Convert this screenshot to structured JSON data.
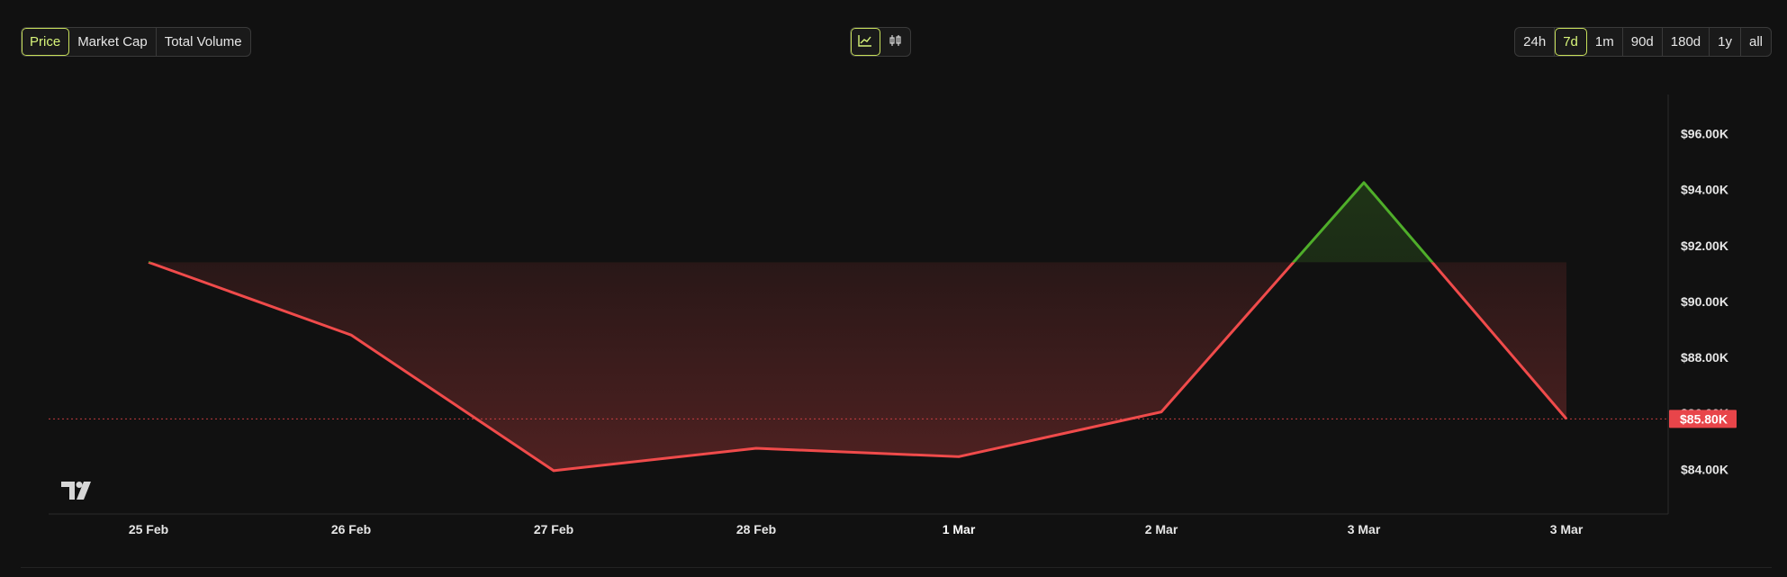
{
  "toolbar": {
    "metrics": [
      {
        "label": "Price",
        "active": true
      },
      {
        "label": "Market Cap",
        "active": false
      },
      {
        "label": "Total Volume",
        "active": false
      }
    ],
    "views": [
      {
        "icon": "line-chart-icon",
        "active": true
      },
      {
        "icon": "candlestick-icon",
        "active": false
      }
    ],
    "ranges": [
      {
        "label": "24h",
        "active": false
      },
      {
        "label": "7d",
        "active": true
      },
      {
        "label": "1m",
        "active": false
      },
      {
        "label": "90d",
        "active": false
      },
      {
        "label": "180d",
        "active": false
      },
      {
        "label": "1y",
        "active": false
      },
      {
        "label": "all",
        "active": false
      }
    ]
  },
  "chart_data": {
    "type": "area",
    "x": [
      "25 Feb",
      "26 Feb",
      "27 Feb",
      "28 Feb",
      "1 Mar",
      "2 Mar",
      "3 Mar",
      "3 Mar"
    ],
    "values": [
      91400,
      88800,
      83950,
      84750,
      84450,
      86050,
      94250,
      85800
    ],
    "baseline": 91400,
    "ylim": [
      82400,
      97400
    ],
    "yticks": [
      84000,
      86000,
      88000,
      90000,
      92000,
      94000,
      96000
    ],
    "ytick_labels": [
      "$84.00K",
      "$86.00K",
      "$88.00K",
      "$90.00K",
      "$92.00K",
      "$94.00K",
      "$96.00K"
    ],
    "current_price_label": "$85.80K",
    "current_price": 85800,
    "bold_tick": "1 Mar",
    "colors": {
      "down": "#f04b4b",
      "up": "#4fae2a",
      "price_tag": "#e8454a",
      "axis_text": "#e6e6e6"
    },
    "watermark": "TV"
  }
}
